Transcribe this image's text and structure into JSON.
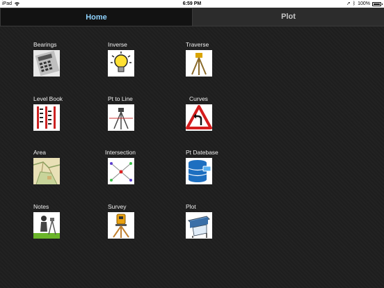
{
  "status": {
    "device": "iPad",
    "time": "6:59 PM",
    "battery": "100%",
    "battery_level": 1.0
  },
  "tabs": [
    {
      "label": "Home",
      "active": true
    },
    {
      "label": "Plot",
      "active": false
    }
  ],
  "grid": [
    {
      "label": "Bearings",
      "icon": "calculator-icon"
    },
    {
      "label": "Inverse",
      "icon": "light-bulb-icon"
    },
    {
      "label": "Traverse",
      "icon": "tripod-icon"
    },
    {
      "label": "Level Book",
      "icon": "level-staff-icon"
    },
    {
      "label": "Pt to Line",
      "icon": "tripod-lines-icon"
    },
    {
      "label": "Curves",
      "icon": "curve-sign-icon"
    },
    {
      "label": "Area",
      "icon": "map-icon"
    },
    {
      "label": "Intersection",
      "icon": "intersection-icon"
    },
    {
      "label": "Pt Datebase",
      "icon": "database-icon"
    },
    {
      "label": "Notes",
      "icon": "surveyor-icon"
    },
    {
      "label": "Survey",
      "icon": "total-station-icon"
    },
    {
      "label": "Plot",
      "icon": "plotter-icon"
    }
  ]
}
